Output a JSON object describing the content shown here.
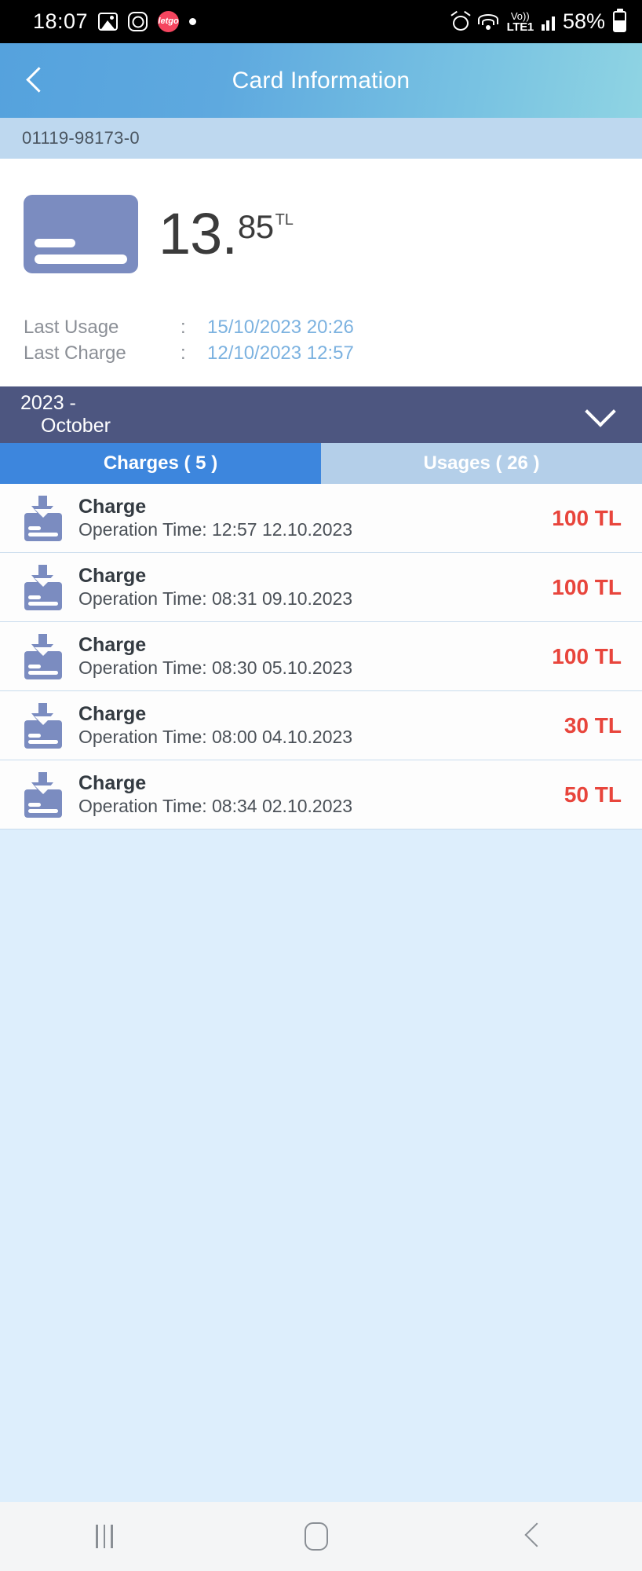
{
  "statusbar": {
    "time": "18:07",
    "icons_left": [
      "gallery-icon",
      "instagram-icon",
      "letgo-icon",
      "dot-indicator"
    ],
    "letgo_label": "letgo",
    "volte_top": "Vo))",
    "volte_bottom": "LTE1",
    "battery_percent": "58%",
    "icons_right": [
      "alarm-icon",
      "wifi-icon",
      "volte-indicator",
      "signal-bars-icon",
      "battery-icon"
    ]
  },
  "header": {
    "title": "Card Information",
    "back_icon": "chevron-left-icon"
  },
  "card": {
    "number": "01119-98173-0",
    "balance_integer": "13",
    "balance_separator": ".",
    "balance_decimal": "85",
    "currency": "TL",
    "card_color": "#7b8cc0"
  },
  "details": [
    {
      "label": "Last Usage",
      "colon": ":",
      "value": "15/10/2023 20:26"
    },
    {
      "label": "Last Charge",
      "colon": ":",
      "value": "12/10/2023 12:57"
    }
  ],
  "period": {
    "year": "2023 -",
    "month": "October",
    "chevron_icon": "chevron-down-icon"
  },
  "tabs": [
    {
      "label": "Charges ( 5 )",
      "active": true,
      "color": "#3d86dd"
    },
    {
      "label": "Usages ( 26 )",
      "active": false,
      "color": "#b4cfe9"
    }
  ],
  "transactions": [
    {
      "title": "Charge",
      "subtitle": "Operation Time: 12:57 12.10.2023",
      "amount": "100 TL"
    },
    {
      "title": "Charge",
      "subtitle": "Operation Time: 08:31 09.10.2023",
      "amount": "100 TL"
    },
    {
      "title": "Charge",
      "subtitle": "Operation Time: 08:30 05.10.2023",
      "amount": "100 TL"
    },
    {
      "title": "Charge",
      "subtitle": "Operation Time: 08:00 04.10.2023",
      "amount": "30 TL"
    },
    {
      "title": "Charge",
      "subtitle": "Operation Time: 08:34 02.10.2023",
      "amount": "50 TL"
    }
  ],
  "colors": {
    "amount_red": "#e8453c",
    "period_bar": "#4d5680",
    "accent_blue": "#3d86dd",
    "value_blue": "#7cb2e0"
  },
  "navbar": {
    "recent_icon": "recent-apps-icon",
    "home_icon": "home-icon",
    "back_icon": "back-icon"
  }
}
